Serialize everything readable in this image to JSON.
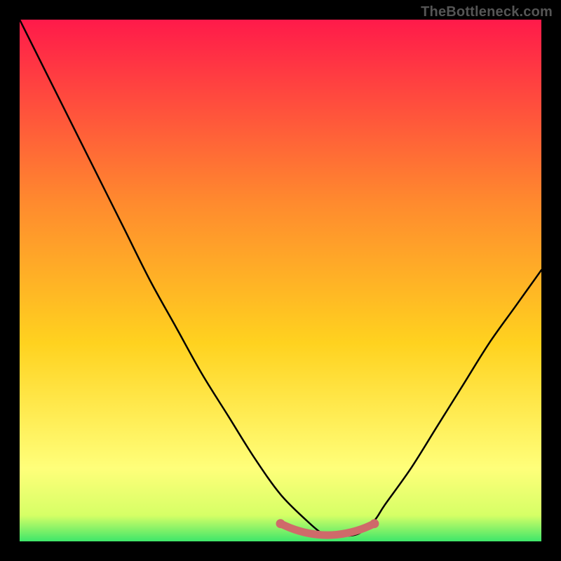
{
  "watermark": "TheBottleneck.com",
  "colors": {
    "background": "#000000",
    "gradient_top": "#ff1a4a",
    "gradient_mid1": "#ff6a3a",
    "gradient_mid2": "#ffd21f",
    "gradient_mid3": "#ffff66",
    "gradient_bottom": "#3ee66a",
    "curve": "#000000",
    "highlight": "#cf6a6a"
  },
  "chart_data": {
    "type": "line",
    "title": "",
    "xlabel": "",
    "ylabel": "",
    "xlim": [
      0,
      100
    ],
    "ylim": [
      0,
      100
    ],
    "series": [
      {
        "name": "curve",
        "x": [
          0,
          5,
          10,
          15,
          20,
          25,
          30,
          35,
          40,
          45,
          50,
          55,
          58,
          60,
          62,
          65,
          68,
          70,
          75,
          80,
          85,
          90,
          95,
          100
        ],
        "y": [
          100,
          90,
          80,
          70,
          60,
          50,
          41,
          32,
          24,
          16,
          9,
          4,
          1.5,
          1,
          1,
          1.5,
          4,
          7,
          14,
          22,
          30,
          38,
          45,
          52
        ]
      }
    ],
    "highlight_range_x": [
      50,
      68
    ],
    "highlight_y": 1.2
  }
}
